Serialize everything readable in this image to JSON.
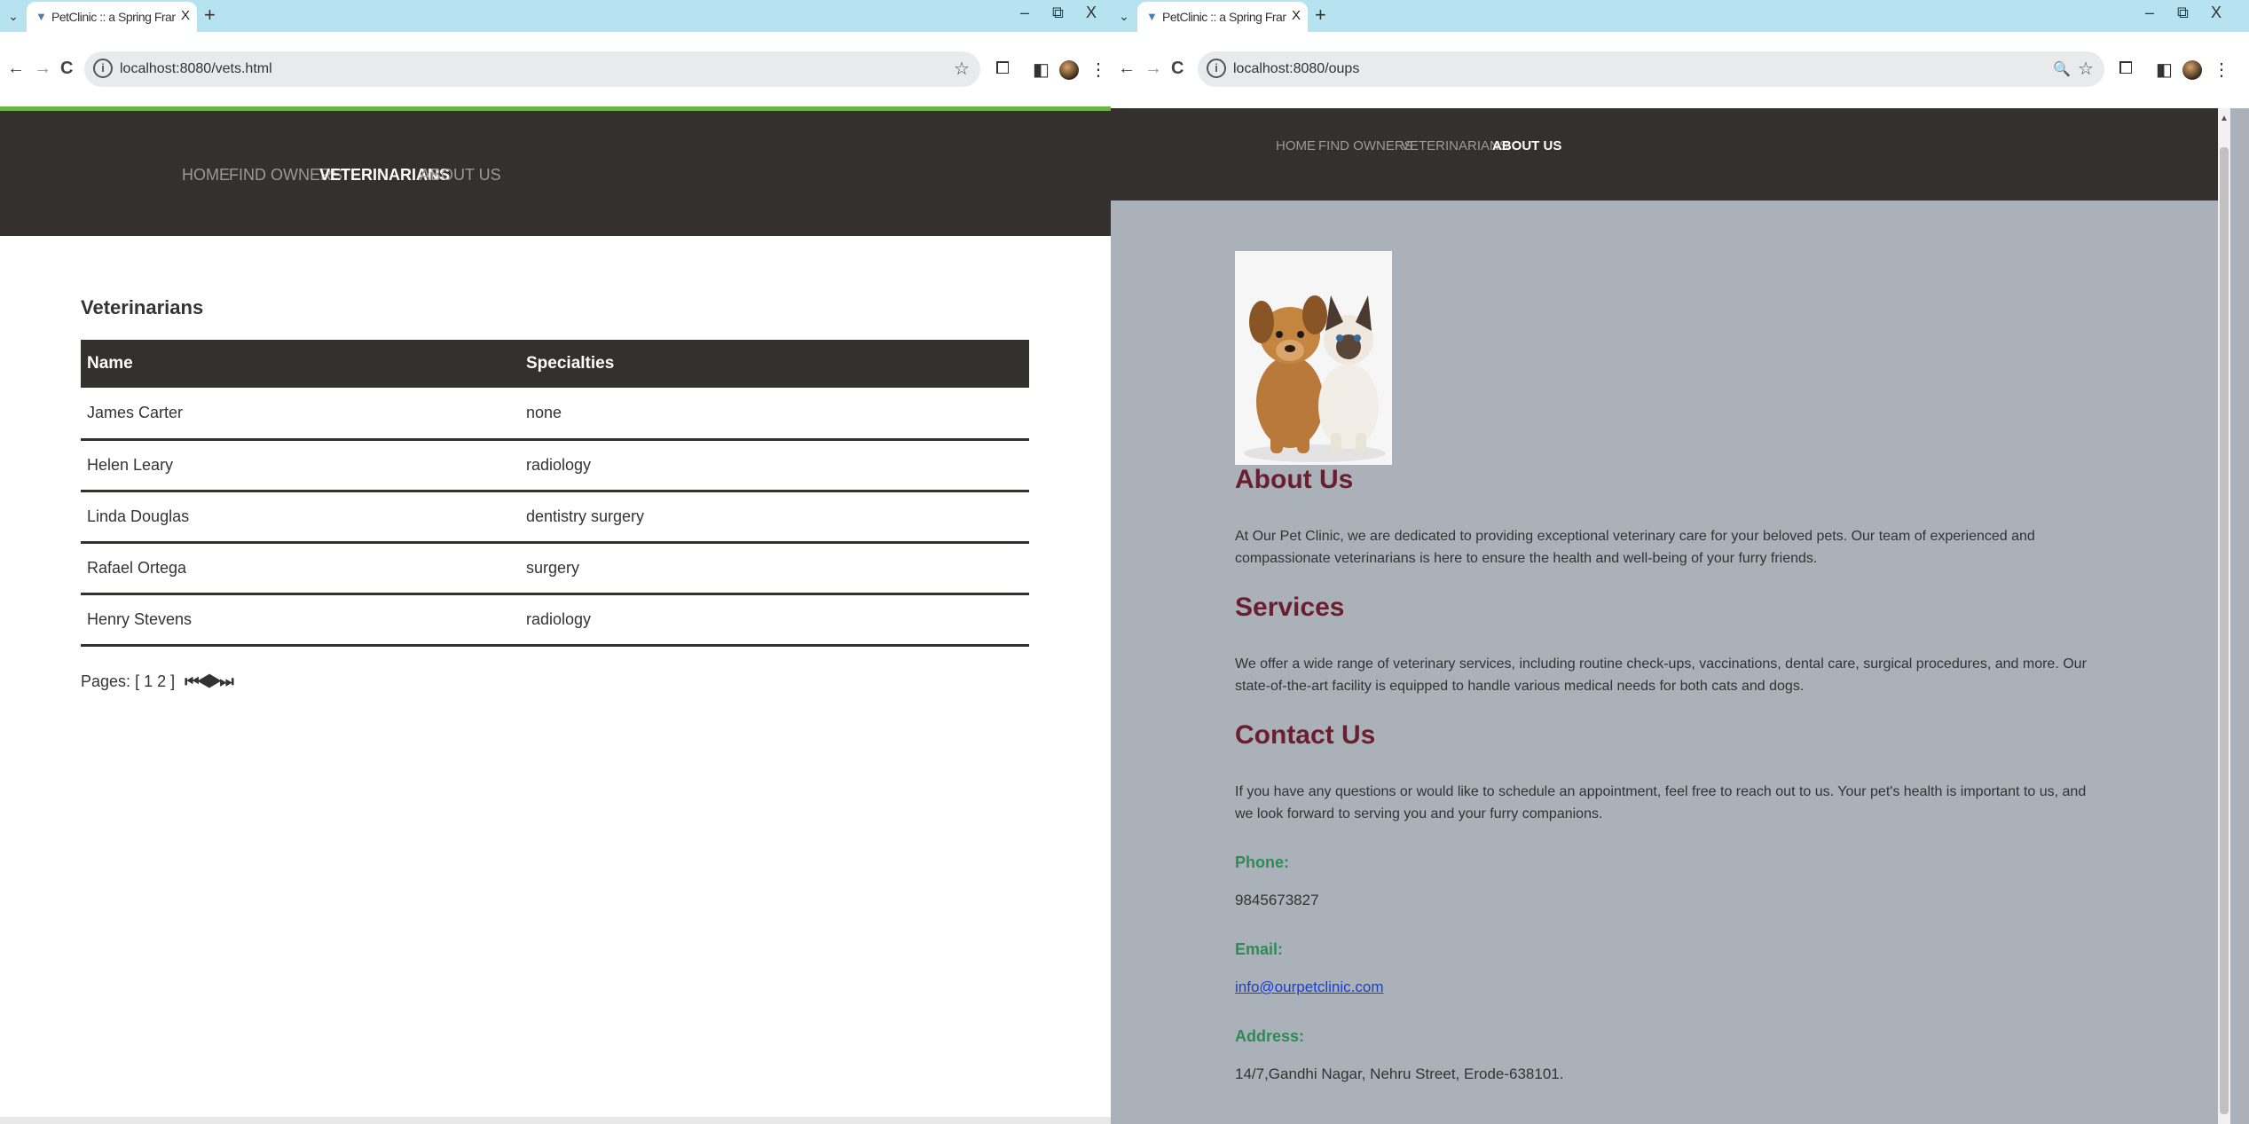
{
  "left": {
    "tab": {
      "title": "PetClinic :: a Spring Framework",
      "close": "X"
    },
    "toolbar": {
      "url": "localhost:8080/vets.html"
    },
    "nav": [
      "HOME",
      "FIND OWNERS",
      "VETERINARIANS",
      "ABOUT US"
    ],
    "nav_active": "VETERINARIANS",
    "page_title": "Veterinarians",
    "table": {
      "headers": [
        "Name",
        "Specialties"
      ],
      "rows": [
        [
          "James Carter",
          "none"
        ],
        [
          "Helen Leary",
          "radiology"
        ],
        [
          "Linda Douglas",
          "dentistry surgery"
        ],
        [
          "Rafael Ortega",
          "surgery"
        ],
        [
          "Henry Stevens",
          "radiology"
        ]
      ]
    },
    "pager": {
      "label": "Pages:",
      "open": "[",
      "page1": "1",
      "page2": "2",
      "close": "]",
      "arrows": "⏮◀▶⏭"
    }
  },
  "right": {
    "tab": {
      "title": "PetClinic :: a Spring Framework",
      "close": "X"
    },
    "toolbar": {
      "url": "localhost:8080/oups"
    },
    "nav": [
      "HOME",
      "FIND OWNERS",
      "VETERINARIANS",
      "ABOUT US"
    ],
    "nav_active": "ABOUT US",
    "about": {
      "heading": "About Us",
      "text": "At Our Pet Clinic, we are dedicated to providing exceptional veterinary care for your beloved pets. Our team of experienced and compassionate veterinarians is here to ensure the health and well-being of your furry friends."
    },
    "services": {
      "heading": "Services",
      "text": "We offer a wide range of veterinary services, including routine check-ups, vaccinations, dental care, surgical procedures, and more. Our state-of-the-art facility is equipped to handle various medical needs for both cats and dogs."
    },
    "contact": {
      "heading": "Contact Us",
      "text": "If you have any questions or would like to schedule an appointment, feel free to reach out to us. Your pet's health is important to us, and we look forward to serving you and your furry companions.",
      "phone_label": "Phone:",
      "phone": "9845673827",
      "email_label": "Email:",
      "email": "info@ourpetclinic.com",
      "address_label": "Address:",
      "address": "14/7,Gandhi Nagar, Nehru Street, Erode-638101."
    }
  },
  "chrome": {
    "tab_menu": "⌄",
    "new_tab": "+",
    "minimize": "–",
    "restore": "⧉",
    "close": "X",
    "back": "←",
    "forward": "→",
    "reload": "C",
    "info": "i",
    "star": "☆",
    "zoom": "🔍",
    "extensions": "⧠",
    "sidebar": "◧",
    "menu": "⋮"
  },
  "colors": {
    "header": "#34302d",
    "accent_green": "#6db33f",
    "right_bg": "#aab1b9",
    "heading_maroon": "#6b1e2e",
    "label_green": "#2e8b57"
  }
}
